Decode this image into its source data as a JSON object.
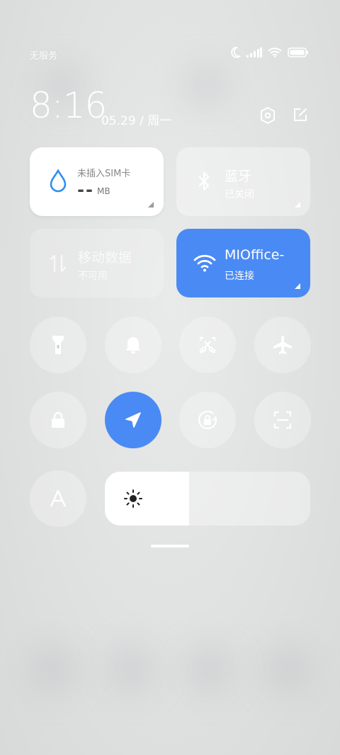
{
  "status_bar": {
    "carrier": "无服务"
  },
  "clock": {
    "time": "8:16",
    "date": "05.29 / 周一"
  },
  "tiles": {
    "data": {
      "title": "未插入SIM卡",
      "value": "--",
      "unit": "MB"
    },
    "bluetooth": {
      "title": "蓝牙",
      "status": "已关闭"
    },
    "mobile_data": {
      "title": "移动数据",
      "status": "不可用"
    },
    "wifi": {
      "title": "MIOffice-",
      "status": "已连接"
    }
  },
  "toggles": [
    {
      "name": "flashlight",
      "active": false
    },
    {
      "name": "bell",
      "active": false
    },
    {
      "name": "screenshot",
      "active": false
    },
    {
      "name": "airplane",
      "active": false
    },
    {
      "name": "lock",
      "active": false
    },
    {
      "name": "location",
      "active": true
    },
    {
      "name": "rotation-lock",
      "active": false
    },
    {
      "name": "scanner",
      "active": false
    },
    {
      "name": "font",
      "active": false
    }
  ],
  "brightness": {
    "level": 0.41
  },
  "colors": {
    "accent": "#4a8af4"
  }
}
